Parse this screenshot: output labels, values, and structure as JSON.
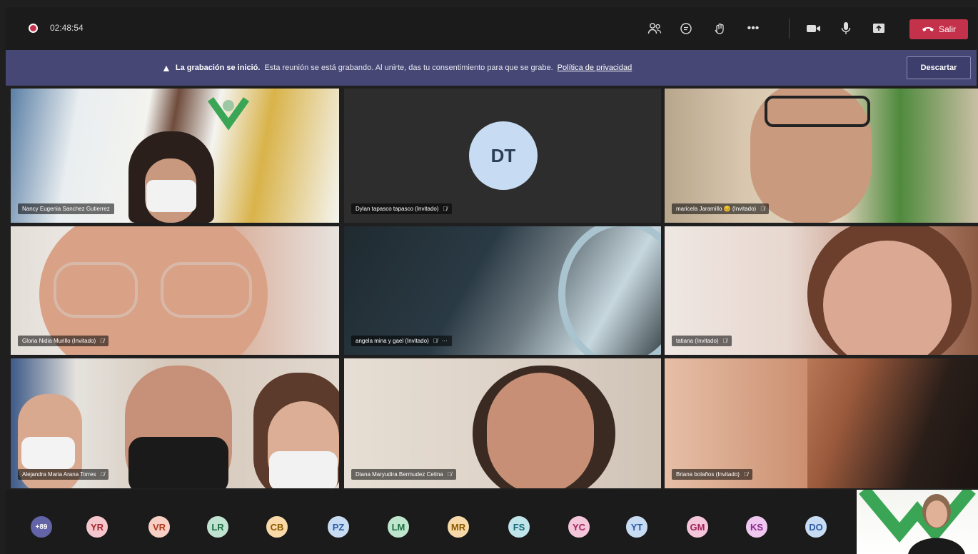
{
  "toolbar": {
    "timer": "02:48:54",
    "leave_label": "Salir",
    "icons": [
      "participants-icon",
      "chat-icon",
      "reactions-icon",
      "more-icon",
      "camera-icon",
      "mic-icon",
      "share-icon"
    ]
  },
  "banner": {
    "title": "La grabación se inició.",
    "message": "Esta reunión se está grabando. Al unirte, das tu consentimiento para que se grabe.",
    "link": "Política de privacidad",
    "dismiss": "Descartar"
  },
  "tiles": [
    {
      "name": "Nancy Eugenia Sanchez Gutierrez",
      "muted": false
    },
    {
      "name": "Dylan tapasco tapasco (Invitado)",
      "muted": true,
      "initials": "DT"
    },
    {
      "name": "maricela Jaramillo 😊 (Invitado)",
      "muted": true
    },
    {
      "name": "Gloria Nidia Murillo (Invitado)",
      "muted": true
    },
    {
      "name": "angela mina y gael (Invitado)",
      "muted": true
    },
    {
      "name": "tatiana (Invitado)",
      "muted": true
    },
    {
      "name": "Alejandra Maria Arana Torres",
      "muted": true
    },
    {
      "name": "Diana Maryudira Bermudez Cetina",
      "muted": true
    },
    {
      "name": "Briana bolaños (Invitado)",
      "muted": true
    }
  ],
  "participants": {
    "overflow": "+89",
    "list": [
      {
        "initials": "YR",
        "bg": "#f5c6cb",
        "fg": "#a4262c"
      },
      {
        "initials": "VR",
        "bg": "#f8cfc4",
        "fg": "#b03a1c"
      },
      {
        "initials": "LR",
        "bg": "#bfe3d0",
        "fg": "#1f6e43"
      },
      {
        "initials": "CB",
        "bg": "#f9d9a8",
        "fg": "#8a5a00"
      },
      {
        "initials": "PZ",
        "bg": "#c7dcf3",
        "fg": "#2b5aa5"
      },
      {
        "initials": "LM",
        "bg": "#bde6cd",
        "fg": "#1f6e43"
      },
      {
        "initials": "MR",
        "bg": "#f7d9a9",
        "fg": "#8a5a00"
      },
      {
        "initials": "FS",
        "bg": "#bfe4ea",
        "fg": "#156a7a"
      },
      {
        "initials": "YC",
        "bg": "#f4c6da",
        "fg": "#a3245d"
      },
      {
        "initials": "YT",
        "bg": "#c7dcf3",
        "fg": "#2b5aa5"
      },
      {
        "initials": "GM",
        "bg": "#f4c6da",
        "fg": "#a3245d"
      },
      {
        "initials": "KS",
        "bg": "#efc7ef",
        "fg": "#8a2b8a"
      },
      {
        "initials": "DO",
        "bg": "#c7dcf3",
        "fg": "#2b5aa5"
      }
    ]
  },
  "colors": {
    "accent": "#464775",
    "leave": "#c4314b",
    "overflow": "#6264a7"
  }
}
